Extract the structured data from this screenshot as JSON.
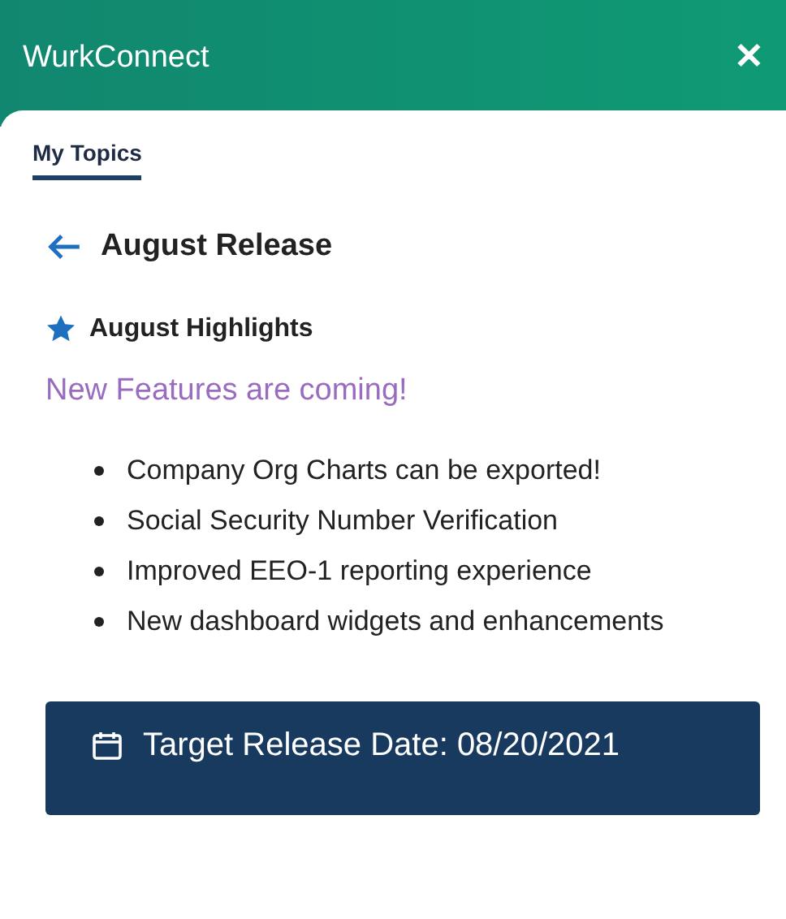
{
  "header": {
    "title": "WurkConnect",
    "close": "✕"
  },
  "tabs": [
    {
      "label": "My Topics",
      "selected": true
    }
  ],
  "page": {
    "title": "August Release",
    "section": "August Highlights",
    "subtitle": "New Features are coming!",
    "bullets": [
      "Company Org Charts can be exported!",
      "Social Security Number Verification",
      "Improved EEO-1 reporting experience",
      "New dashboard widgets and enhancements"
    ]
  },
  "banner": {
    "text": "Target Release Date: 08/20/2021"
  }
}
